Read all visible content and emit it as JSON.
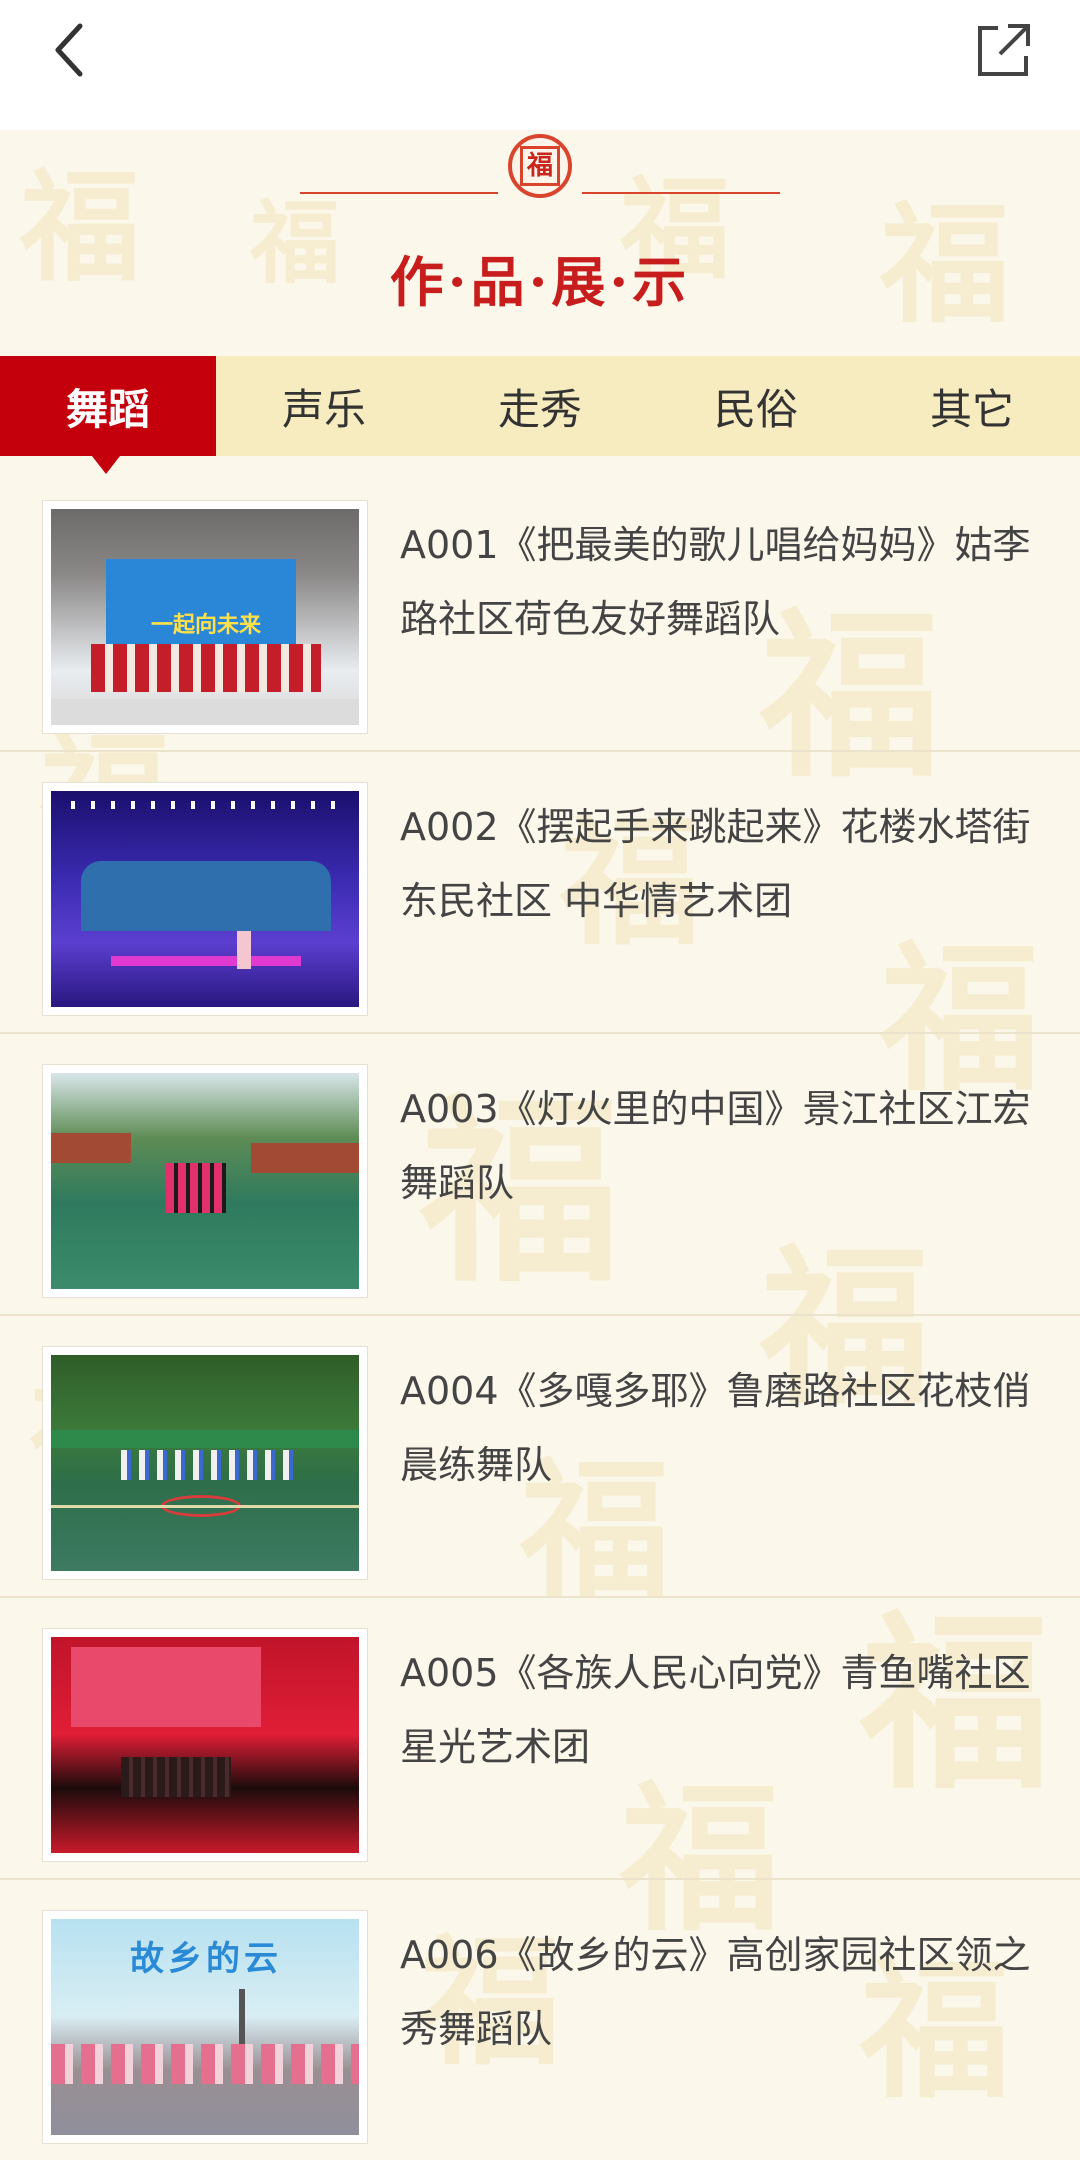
{
  "topbar": {
    "back_icon": "chevron-left-icon",
    "share_icon": "external-share-icon"
  },
  "header": {
    "seal_char": "福",
    "title": "作·品·展·示"
  },
  "tabs": [
    {
      "label": "舞蹈",
      "active": true
    },
    {
      "label": "声乐",
      "active": false
    },
    {
      "label": "走秀",
      "active": false
    },
    {
      "label": "民俗",
      "active": false
    },
    {
      "label": "其它",
      "active": false
    }
  ],
  "items": [
    {
      "title": "A001《把最美的歌儿唱给妈妈》姑李路社区荷色友好舞蹈队",
      "thumb_text": "一起向未来"
    },
    {
      "title": "A002《摆起手来跳起来》花楼水塔街东民社区 中华情艺术团",
      "thumb_text": ""
    },
    {
      "title": "A003《灯火里的中国》景江社区江宏舞蹈队",
      "thumb_text": ""
    },
    {
      "title": "A004《多嘎多耶》鲁磨路社区花枝俏晨练舞队",
      "thumb_text": ""
    },
    {
      "title": "A005《各族人民心向党》青鱼嘴社区星光艺术团",
      "thumb_text": ""
    },
    {
      "title": "A006《故乡的云》高创家园社区领之秀舞蹈队",
      "thumb_text": "故乡的云"
    }
  ],
  "colors": {
    "accent": "#c4000d",
    "tab_bar": "#f7ecc0",
    "background": "#fbf7ea"
  }
}
